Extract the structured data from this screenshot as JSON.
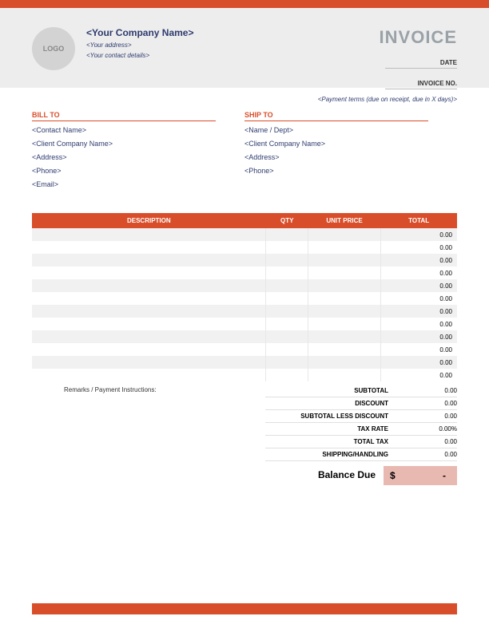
{
  "logo_text": "LOGO",
  "company": {
    "name": "<Your Company Name>",
    "address": "<Your address>",
    "contact": "<Your contact details>"
  },
  "invoice_title": "INVOICE",
  "meta": {
    "date_label": "DATE",
    "invoice_no_label": "INVOICE NO."
  },
  "payment_terms": "<Payment terms (due on receipt, due in X days)>",
  "bill_to": {
    "heading": "BILL TO",
    "lines": [
      "<Contact Name>",
      "<Client Company Name>",
      "<Address>",
      "<Phone>",
      "<Email>"
    ]
  },
  "ship_to": {
    "heading": "SHIP TO",
    "lines": [
      "<Name / Dept>",
      "<Client Company Name>",
      "<Address>",
      "<Phone>"
    ]
  },
  "columns": {
    "description": "DESCRIPTION",
    "qty": "QTY",
    "unit_price": "UNIT PRICE",
    "total": "TOTAL"
  },
  "rows": [
    {
      "desc": "",
      "qty": "",
      "price": "",
      "total": "0.00"
    },
    {
      "desc": "",
      "qty": "",
      "price": "",
      "total": "0.00"
    },
    {
      "desc": "",
      "qty": "",
      "price": "",
      "total": "0.00"
    },
    {
      "desc": "",
      "qty": "",
      "price": "",
      "total": "0.00"
    },
    {
      "desc": "",
      "qty": "",
      "price": "",
      "total": "0.00"
    },
    {
      "desc": "",
      "qty": "",
      "price": "",
      "total": "0.00"
    },
    {
      "desc": "",
      "qty": "",
      "price": "",
      "total": "0.00"
    },
    {
      "desc": "",
      "qty": "",
      "price": "",
      "total": "0.00"
    },
    {
      "desc": "",
      "qty": "",
      "price": "",
      "total": "0.00"
    },
    {
      "desc": "",
      "qty": "",
      "price": "",
      "total": "0.00"
    },
    {
      "desc": "",
      "qty": "",
      "price": "",
      "total": "0.00"
    },
    {
      "desc": "",
      "qty": "",
      "price": "",
      "total": "0.00"
    }
  ],
  "remarks_label": "Remarks / Payment Instructions:",
  "totals": {
    "subtotal_label": "SUBTOTAL",
    "subtotal": "0.00",
    "discount_label": "DISCOUNT",
    "discount": "0.00",
    "subtotal_less_label": "SUBTOTAL LESS DISCOUNT",
    "subtotal_less": "0.00",
    "tax_rate_label": "TAX RATE",
    "tax_rate": "0.00%",
    "total_tax_label": "TOTAL TAX",
    "total_tax": "0.00",
    "shipping_label": "SHIPPING/HANDLING",
    "shipping": "0.00"
  },
  "balance": {
    "label": "Balance Due",
    "currency": "$",
    "amount": "-"
  }
}
